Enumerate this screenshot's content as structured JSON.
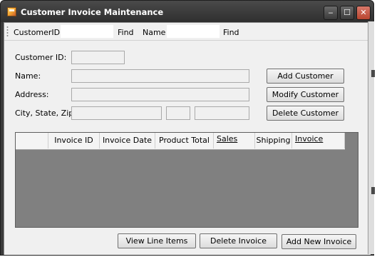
{
  "window": {
    "title": "Customer Invoice Maintenance",
    "controls": {
      "minimize": "‒",
      "maximize": "☐",
      "close": "✕"
    }
  },
  "toolbar": {
    "customer_id_label": "CustomerID:",
    "customer_id_value": "",
    "find1_label": "Find",
    "name_label": "Name",
    "name_value": "",
    "find2_label": "Find"
  },
  "form": {
    "customer_id_label": "Customer ID:",
    "name_label": "Name:",
    "address_label": "Address:",
    "city_state_zip_label": "City, State, Zip:",
    "customer_id_value": "",
    "name_value": "",
    "address_value": "",
    "city_value": "",
    "state_value": "",
    "zip_value": ""
  },
  "actions": {
    "add_customer": "Add Customer",
    "modify_customer": "Modify Customer",
    "delete_customer": "Delete Customer"
  },
  "invoice_grid": {
    "columns": [
      "Invoice ID",
      "Invoice Date",
      "Product Total",
      "Sales",
      "Shipping",
      "Invoice"
    ],
    "rows": []
  },
  "bottom_actions": {
    "view_line_items": "View Line Items",
    "delete_invoice": "Delete Invoice",
    "add_new_invoice": "Add New Invoice"
  },
  "colors": {
    "titlebar": "#3b3b3b",
    "client_bg": "#f0f0f0",
    "grid_bg": "#808080"
  }
}
